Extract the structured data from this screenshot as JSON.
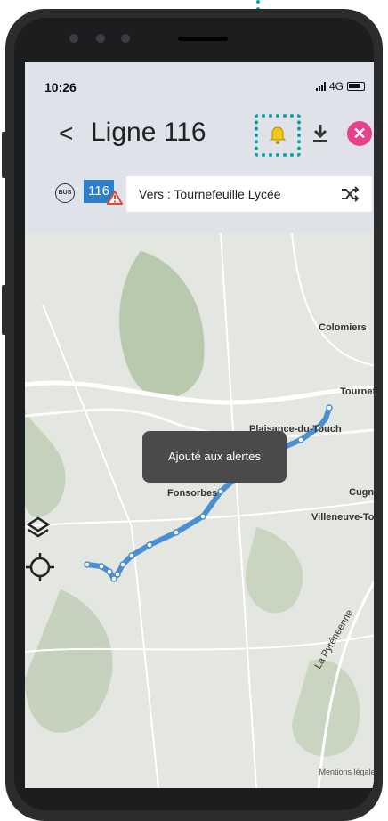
{
  "status_bar": {
    "time": "10:26",
    "network": "4G"
  },
  "header": {
    "back_glyph": "<",
    "title": "Ligne 116",
    "close_glyph": "✕"
  },
  "line": {
    "mode_badge": "BUS",
    "number": "116",
    "direction": "Vers : Tournefeuille Lycée"
  },
  "map": {
    "places": [
      "Colomiers",
      "Tournefe",
      "Plaisance-du-Touch",
      "Fonsorbes",
      "Cugna",
      "Villeneuve-To",
      "La Pyrénéenne"
    ],
    "legal_link": "Mentions légales"
  },
  "toast": {
    "message": "Ajouté aux alertes"
  },
  "colors": {
    "accent_dotted": "#0aa3a6",
    "line_blue": "#2c7fc8",
    "close_pink": "#e5428a",
    "bell_yellow": "#f5c518"
  },
  "icons": [
    "bell-icon",
    "download-icon",
    "close-icon",
    "bus-icon",
    "warning-icon",
    "shuffle-icon",
    "layers-icon",
    "locate-icon"
  ]
}
